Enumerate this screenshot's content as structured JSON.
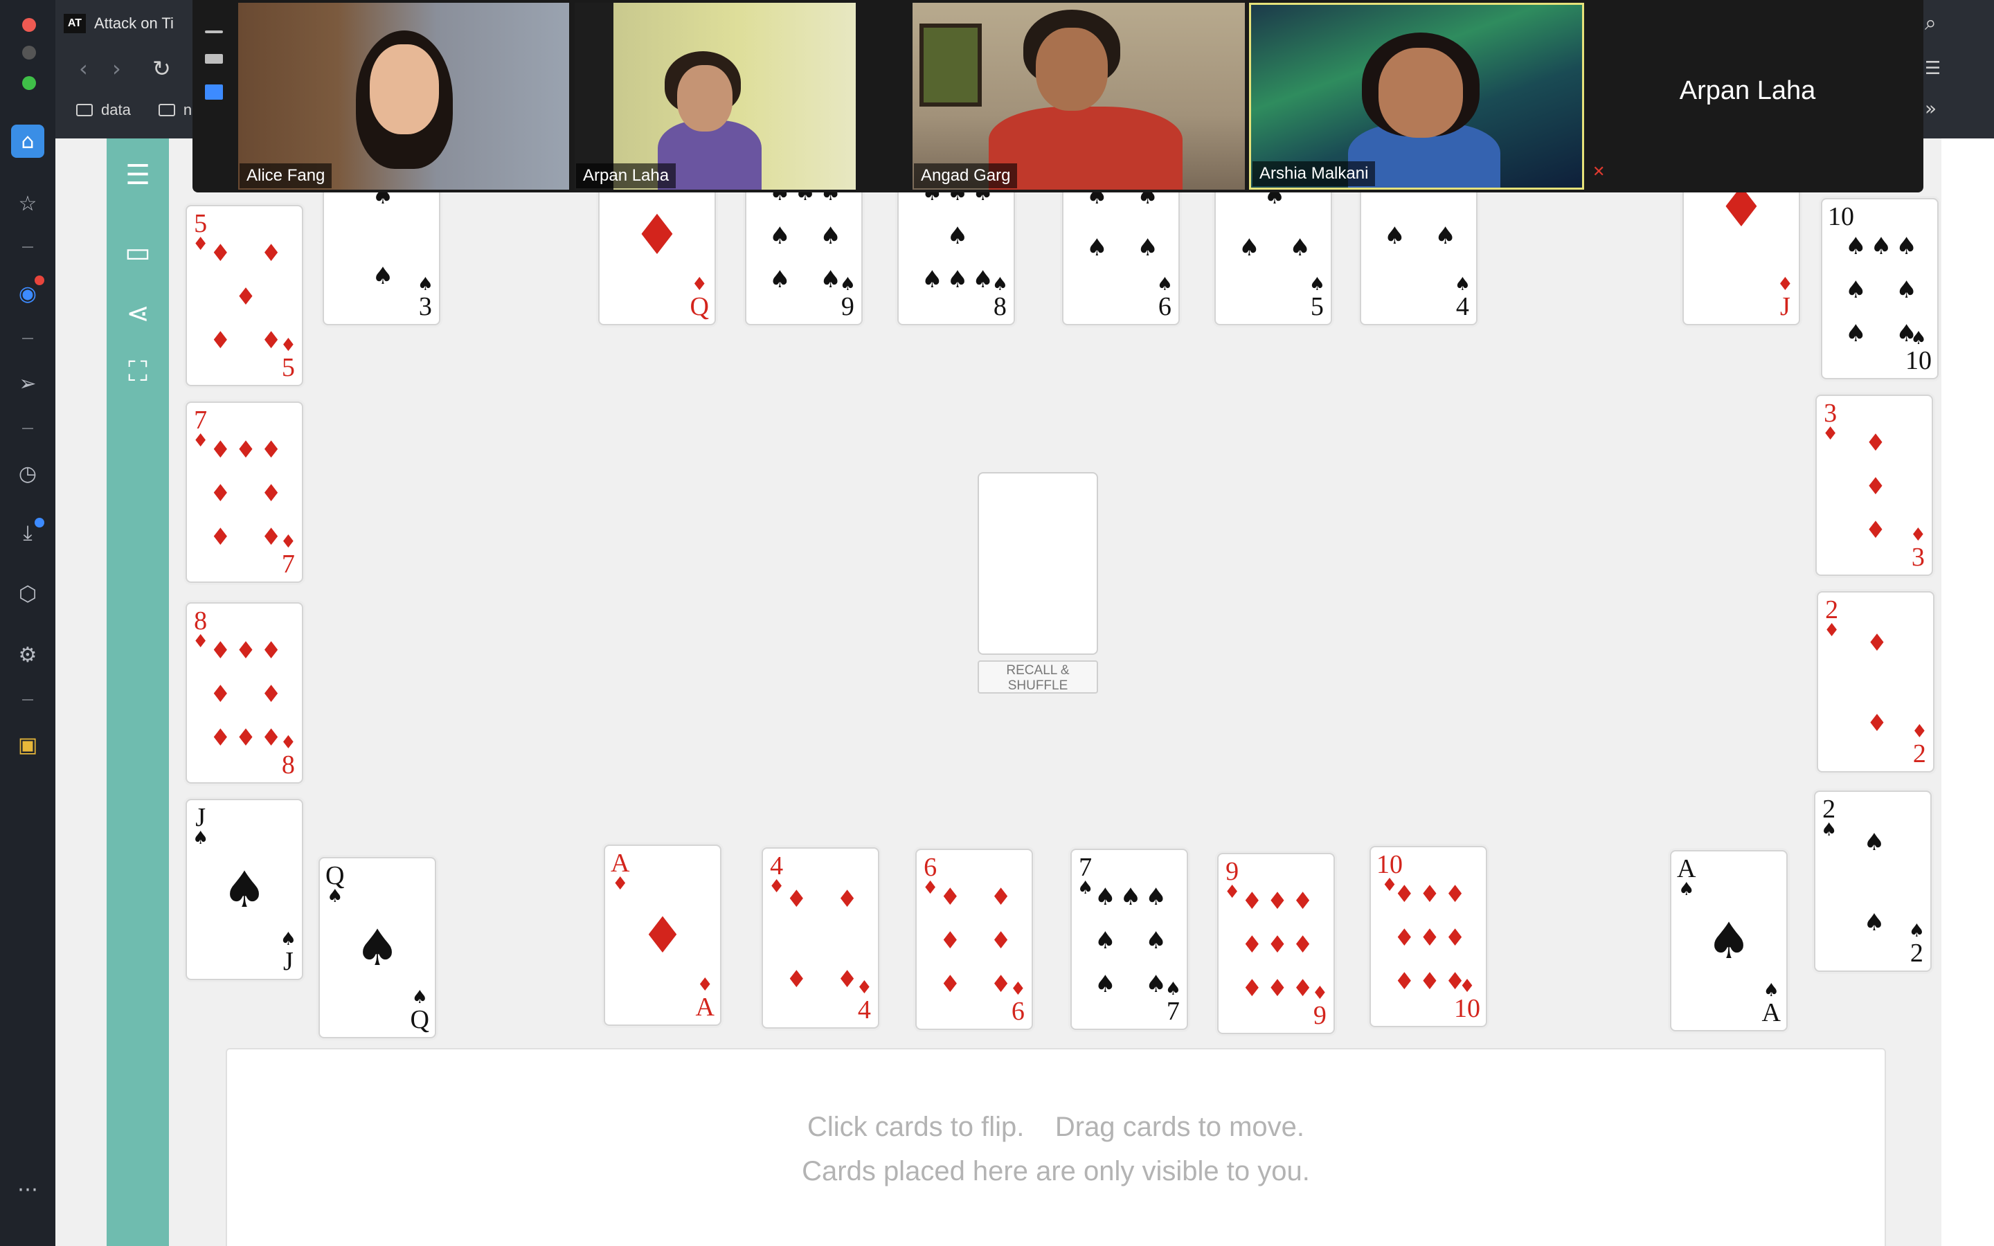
{
  "browser": {
    "tab_title": "Attack on Ti",
    "tab_favicon": "AT",
    "bookmarks": [
      "data",
      "n"
    ]
  },
  "zoom": {
    "participants": [
      {
        "name": "Alice Fang"
      },
      {
        "name": "Arpan Laha"
      },
      {
        "name": "Angad Garg"
      },
      {
        "name": "Arshia Malkani"
      }
    ],
    "speaker_name": "Arpan Laha"
  },
  "deck": {
    "recall_label_line1": "RECALL &",
    "recall_label_line2": "SHUFFLE"
  },
  "private_area": {
    "line1": "Click cards to flip.    Drag cards to move.",
    "line2": "Cards placed here are only visible to you."
  },
  "cards": {
    "top_row": [
      {
        "rank": "3",
        "suit": "♠"
      },
      {
        "rank": "Q",
        "suit": "♦"
      },
      {
        "rank": "9",
        "suit": "♠"
      },
      {
        "rank": "8",
        "suit": "♠"
      },
      {
        "rank": "6",
        "suit": "♠"
      },
      {
        "rank": "5",
        "suit": "♠"
      },
      {
        "rank": "4",
        "suit": "♠"
      },
      {
        "rank": "J",
        "suit": "♦"
      },
      {
        "rank": "10",
        "suit": "♠"
      }
    ],
    "left_column": [
      {
        "rank": "5",
        "suit": "♦"
      },
      {
        "rank": "7",
        "suit": "♦"
      },
      {
        "rank": "8",
        "suit": "♦"
      },
      {
        "rank": "J",
        "suit": "♠"
      }
    ],
    "right_column": [
      {
        "rank": "3",
        "suit": "♦"
      },
      {
        "rank": "2",
        "suit": "♦"
      },
      {
        "rank": "2",
        "suit": "♠"
      }
    ],
    "bottom_row": [
      {
        "rank": "Q",
        "suit": "♠"
      },
      {
        "rank": "A",
        "suit": "♦"
      },
      {
        "rank": "4",
        "suit": "♦"
      },
      {
        "rank": "6",
        "suit": "♦"
      },
      {
        "rank": "7",
        "suit": "♠"
      },
      {
        "rank": "9",
        "suit": "♦"
      },
      {
        "rank": "10",
        "suit": "♦"
      },
      {
        "rank": "A",
        "suit": "♠"
      }
    ]
  },
  "colors": {
    "site_sidebar": "#6fbcaf",
    "red_suit": "#d3241c",
    "black_suit": "#111111",
    "active_speaker_border": "#e6e27a"
  },
  "icons": {
    "browser_sidebar": [
      "home-icon",
      "star-icon",
      "messenger-icon",
      "send-icon",
      "history-icon",
      "download-icon",
      "box-icon",
      "settings-icon",
      "lightbulb-icon",
      "more-icon"
    ],
    "site_sidebar": [
      "menu-icon",
      "briefcase-icon",
      "share-icon",
      "fullscreen-icon"
    ]
  }
}
